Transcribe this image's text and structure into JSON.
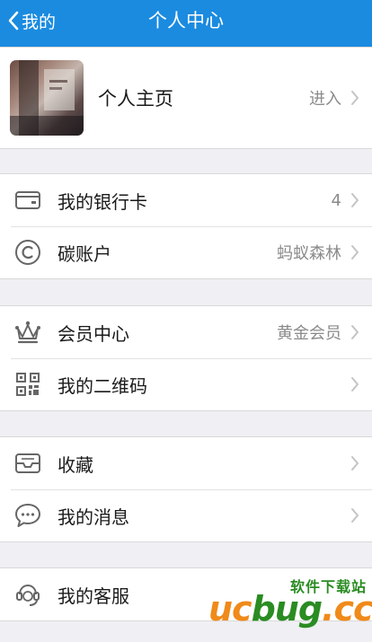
{
  "nav": {
    "back_label": "我的",
    "title": "个人中心"
  },
  "profile": {
    "label": "个人主页",
    "value": "进入"
  },
  "groups": [
    {
      "items": [
        {
          "icon": "bank-card-icon",
          "label": "我的银行卡",
          "value": "4"
        },
        {
          "icon": "copyright-c-icon",
          "label": "碳账户",
          "value": "蚂蚁森林"
        }
      ]
    },
    {
      "items": [
        {
          "icon": "crown-icon",
          "label": "会员中心",
          "value": "黄金会员"
        },
        {
          "icon": "qr-code-icon",
          "label": "我的二维码",
          "value": ""
        }
      ]
    },
    {
      "items": [
        {
          "icon": "inbox-tray-icon",
          "label": "收藏",
          "value": ""
        },
        {
          "icon": "chat-bubble-icon",
          "label": "我的消息",
          "value": ""
        }
      ]
    },
    {
      "items": [
        {
          "icon": "headset-icon",
          "label": "我的客服",
          "value": ""
        }
      ]
    }
  ],
  "watermark": {
    "top_text": "软件下载站",
    "logo_text_1": "uc",
    "logo_text_2": "bug",
    "logo_text_3": ".cc"
  },
  "colors": {
    "nav_bg": "#1b8be0",
    "background": "#efeff4",
    "watermark_orange": "#f08a1a",
    "watermark_green": "#2a8c22"
  }
}
